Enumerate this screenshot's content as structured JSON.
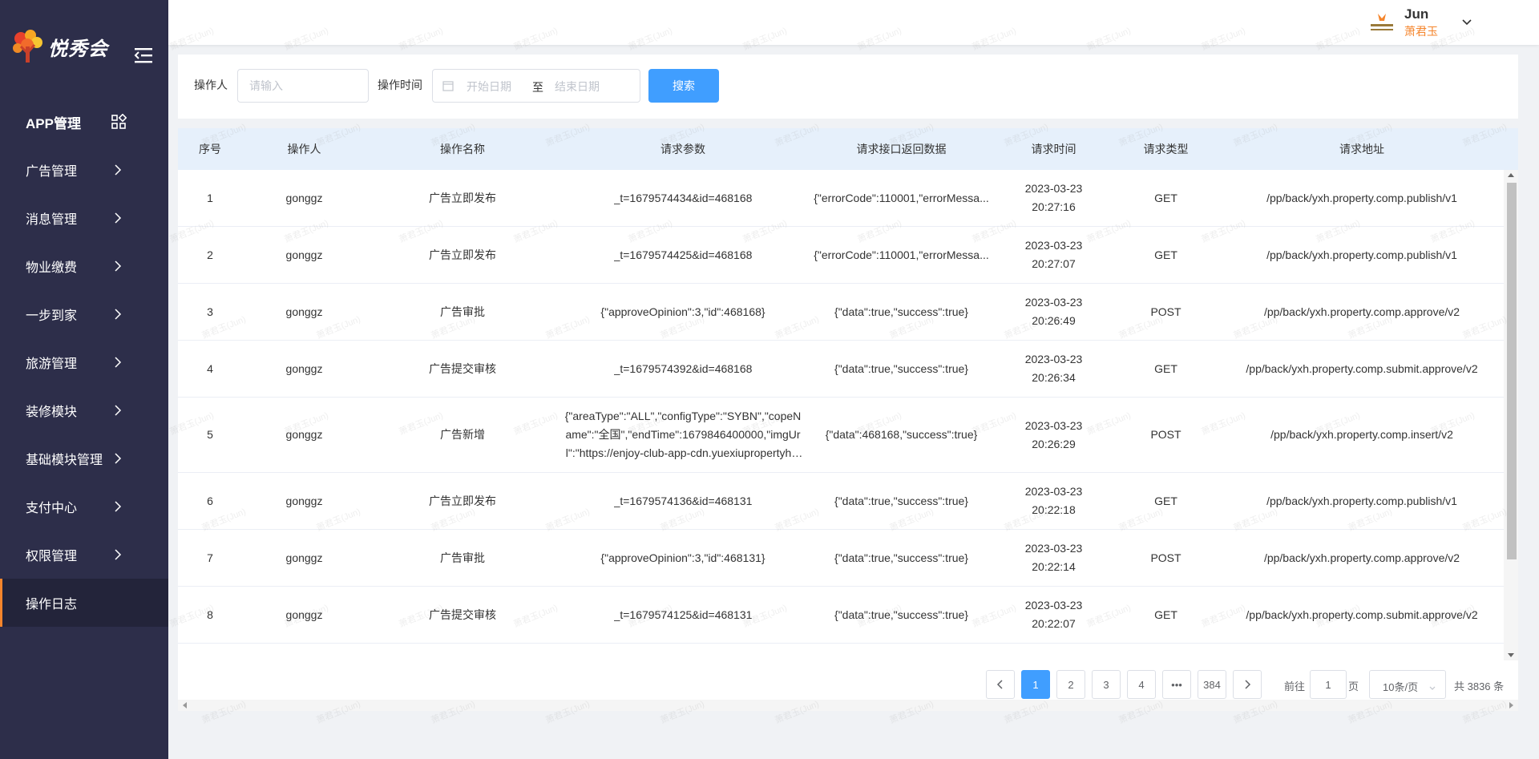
{
  "app": {
    "brand_name": "悦秀会"
  },
  "sidebar": {
    "items": [
      {
        "label": "APP管理"
      },
      {
        "label": "广告管理"
      },
      {
        "label": "消息管理"
      },
      {
        "label": "物业缴费"
      },
      {
        "label": "一步到家"
      },
      {
        "label": "旅游管理"
      },
      {
        "label": "装修模块"
      },
      {
        "label": "基础模块管理"
      },
      {
        "label": "支付中心"
      },
      {
        "label": "权限管理"
      },
      {
        "label": "操作日志"
      }
    ],
    "active_label": "操作日志"
  },
  "header": {
    "user_name": "Jun",
    "user_role": "萧君玉",
    "avatar_icon": "company-logo-icon"
  },
  "filter": {
    "operator_label": "操作人",
    "operator_placeholder": "请输入",
    "time_label": "操作时间",
    "start_placeholder": "开始日期",
    "range_separator": "至",
    "end_placeholder": "结束日期",
    "search_label": "搜索"
  },
  "table": {
    "columns": [
      "序号",
      "操作人",
      "操作名称",
      "请求参数",
      "请求接口返回数据",
      "请求时间",
      "请求类型",
      "请求地址"
    ],
    "rows": [
      {
        "index": "1",
        "operator": "gonggz",
        "action": "广告立即发布",
        "params": "_t=1679574434&id=468168",
        "response": "{\"errorCode\":110001,\"errorMessa...",
        "date": "2023-03-23",
        "time": "20:27:16",
        "method": "GET",
        "url": "/pp/back/yxh.property.comp.publish/v1"
      },
      {
        "index": "2",
        "operator": "gonggz",
        "action": "广告立即发布",
        "params": "_t=1679574425&id=468168",
        "response": "{\"errorCode\":110001,\"errorMessa...",
        "date": "2023-03-23",
        "time": "20:27:07",
        "method": "GET",
        "url": "/pp/back/yxh.property.comp.publish/v1"
      },
      {
        "index": "3",
        "operator": "gonggz",
        "action": "广告审批",
        "params": "{\"approveOpinion\":3,\"id\":468168}",
        "response": "{\"data\":true,\"success\":true}",
        "date": "2023-03-23",
        "time": "20:26:49",
        "method": "POST",
        "url": "/pp/back/yxh.property.comp.approve/v2"
      },
      {
        "index": "4",
        "operator": "gonggz",
        "action": "广告提交审核",
        "params": "_t=1679574392&id=468168",
        "response": "{\"data\":true,\"success\":true}",
        "date": "2023-03-23",
        "time": "20:26:34",
        "method": "GET",
        "url": "/pp/back/yxh.property.comp.submit.approve/v2"
      },
      {
        "index": "5",
        "operator": "gonggz",
        "action": "广告新增",
        "params": "{\"areaType\":\"ALL\",\"configType\":\"SYBN\",\"copeName\":\"全国\",\"endTime\":1679846400000,\"imgUrl\":\"https://enjoy-club-app-cdn.yuexiupropertyhk.com\"}",
        "response": "{\"data\":468168,\"success\":true}",
        "date": "2023-03-23",
        "time": "20:26:29",
        "method": "POST",
        "url": "/pp/back/yxh.property.comp.insert/v2"
      },
      {
        "index": "6",
        "operator": "gonggz",
        "action": "广告立即发布",
        "params": "_t=1679574136&id=468131",
        "response": "{\"data\":true,\"success\":true}",
        "date": "2023-03-23",
        "time": "20:22:18",
        "method": "GET",
        "url": "/pp/back/yxh.property.comp.publish/v1"
      },
      {
        "index": "7",
        "operator": "gonggz",
        "action": "广告审批",
        "params": "{\"approveOpinion\":3,\"id\":468131}",
        "response": "{\"data\":true,\"success\":true}",
        "date": "2023-03-23",
        "time": "20:22:14",
        "method": "POST",
        "url": "/pp/back/yxh.property.comp.approve/v2"
      },
      {
        "index": "8",
        "operator": "gonggz",
        "action": "广告提交审核",
        "params": "_t=1679574125&id=468131",
        "response": "{\"data\":true,\"success\":true}",
        "date": "2023-03-23",
        "time": "20:22:07",
        "method": "GET",
        "url": "/pp/back/yxh.property.comp.submit.approve/v2"
      },
      {
        "index": "",
        "operator": "",
        "action": "",
        "params": "{\"areaType\":\"ALL\",\"configType\":\"SYBN\",\"cope",
        "response": "",
        "date": "",
        "time": "",
        "method": "",
        "url": ""
      }
    ]
  },
  "pagination": {
    "pages": [
      "1",
      "2",
      "3",
      "4",
      "•••",
      "384"
    ],
    "current": "1",
    "goto_prefix": "前往",
    "goto_value": "1",
    "goto_suffix": "页",
    "page_size": "10条/页",
    "total": "共 3836 条"
  },
  "watermark": "萧君玉(Jun)",
  "colors": {
    "sidebar_bg": "#2d2e4a",
    "accent": "#409eff",
    "active_marker": "#f5852c",
    "header_row_bg": "#e6f0fb"
  }
}
